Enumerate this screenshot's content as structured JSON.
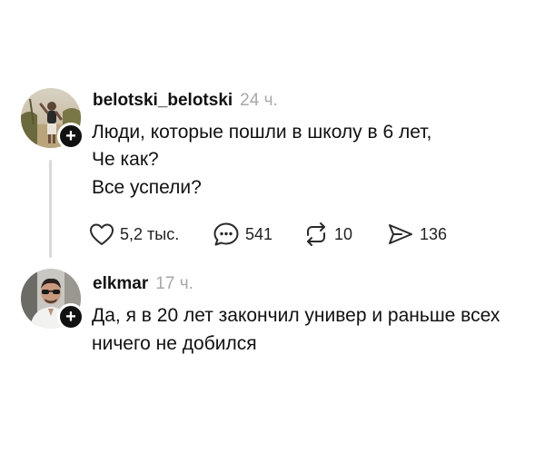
{
  "posts": [
    {
      "username": "belotski_belotski",
      "timestamp": "24 ч.",
      "lines": [
        "Люди, которые пошли в школу в 6 лет,",
        "Че как?",
        "Все успели?"
      ],
      "follow_symbol": "+",
      "actions": {
        "like": {
          "icon": "heart-icon",
          "count": "5,2 тыс."
        },
        "comment": {
          "icon": "comment-bubble-icon",
          "count": "541"
        },
        "repost": {
          "icon": "repost-icon",
          "count": "10"
        },
        "share": {
          "icon": "send-icon",
          "count": "136"
        }
      }
    },
    {
      "username": "elkmar",
      "timestamp": "17 ч.",
      "lines": [
        "Да, я в 20 лет закончил универ и раньше всех",
        "ничего не добился"
      ],
      "follow_symbol": "+"
    }
  ]
}
